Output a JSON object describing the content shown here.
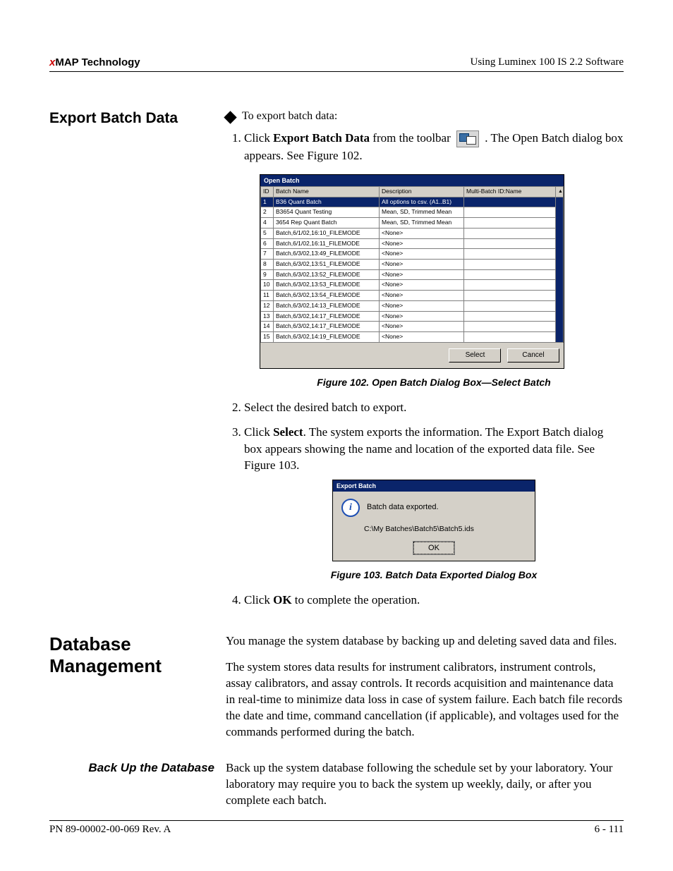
{
  "header": {
    "left_prefix": "x",
    "left_rest": "MAP Technology",
    "right": "Using Luminex 100 IS 2.2 Software"
  },
  "footer": {
    "left": "PN 89-00002-00-069 Rev. A",
    "right": "6 - 111"
  },
  "section1": {
    "heading": "Export Batch Data",
    "intro": "To export batch data:",
    "step1_a": "Click ",
    "step1_b": "Export Batch Data",
    "step1_c": " from the toolbar ",
    "step1_d": " . The Open Batch dialog box appears. See Figure 102.",
    "step2": "Select the desired batch to export.",
    "step3_a": "Click ",
    "step3_b": "Select",
    "step3_c": ". The system exports the information. The Export Batch dialog box appears showing the name and location of the exported data file. See Figure 103.",
    "step4_a": "Click ",
    "step4_b": "OK",
    "step4_c": " to complete the operation."
  },
  "fig102": {
    "caption": "Figure 102.  Open Batch Dialog Box—Select Batch",
    "title": "Open Batch",
    "cols": {
      "id": "ID",
      "name": "Batch Name",
      "desc": "Description",
      "mb": "Multi-Batch ID:Name"
    },
    "rows": [
      {
        "id": "1",
        "name": "B36 Quant Batch",
        "desc": "All options to csv. (A1..B1)",
        "mb": ""
      },
      {
        "id": "2",
        "name": "B3654 Quant Testing",
        "desc": "Mean, SD, Trimmed Mean",
        "mb": ""
      },
      {
        "id": "4",
        "name": "3654 Rep Quant Batch",
        "desc": "Mean, SD, Trimmed Mean",
        "mb": ""
      },
      {
        "id": "5",
        "name": "Batch,6/1/02,16:10_FILEMODE",
        "desc": "<None>",
        "mb": ""
      },
      {
        "id": "6",
        "name": "Batch,6/1/02,16:11_FILEMODE",
        "desc": "<None>",
        "mb": ""
      },
      {
        "id": "7",
        "name": "Batch,6/3/02,13:49_FILEMODE",
        "desc": "<None>",
        "mb": ""
      },
      {
        "id": "8",
        "name": "Batch,6/3/02,13:51_FILEMODE",
        "desc": "<None>",
        "mb": ""
      },
      {
        "id": "9",
        "name": "Batch,6/3/02,13:52_FILEMODE",
        "desc": "<None>",
        "mb": ""
      },
      {
        "id": "10",
        "name": "Batch,6/3/02,13:53_FILEMODE",
        "desc": "<None>",
        "mb": ""
      },
      {
        "id": "11",
        "name": "Batch,6/3/02,13:54_FILEMODE",
        "desc": "<None>",
        "mb": ""
      },
      {
        "id": "12",
        "name": "Batch,6/3/02,14:13_FILEMODE",
        "desc": "<None>",
        "mb": ""
      },
      {
        "id": "13",
        "name": "Batch,6/3/02,14:17_FILEMODE",
        "desc": "<None>",
        "mb": ""
      },
      {
        "id": "14",
        "name": "Batch,6/3/02,14:17_FILEMODE",
        "desc": "<None>",
        "mb": ""
      },
      {
        "id": "15",
        "name": "Batch,6/3/02,14:19_FILEMODE",
        "desc": "<None>",
        "mb": ""
      }
    ],
    "buttons": {
      "select": "Select",
      "cancel": "Cancel"
    }
  },
  "fig103": {
    "caption": "Figure 103.  Batch Data Exported Dialog Box",
    "title": "Export Batch",
    "msg": "Batch data exported.",
    "path": "C:\\My Batches\\Batch5\\Batch5.ids",
    "ok": "OK"
  },
  "section2": {
    "heading": "Database Management",
    "p1": "You manage the system database by backing up and deleting saved data and files.",
    "p2": "The system stores data results for instrument calibrators, instrument controls, assay calibrators, and assay controls. It records acquisition and maintenance data in real-time to minimize data loss in case of system failure. Each batch file records the date and time, command cancellation (if applicable), and voltages used for the commands performed during the batch.",
    "sub1_heading": "Back Up the Database",
    "sub1_p": "Back up the system database following the schedule set by your laboratory. Your laboratory may require you to back the system up weekly, daily, or after you complete each batch."
  }
}
